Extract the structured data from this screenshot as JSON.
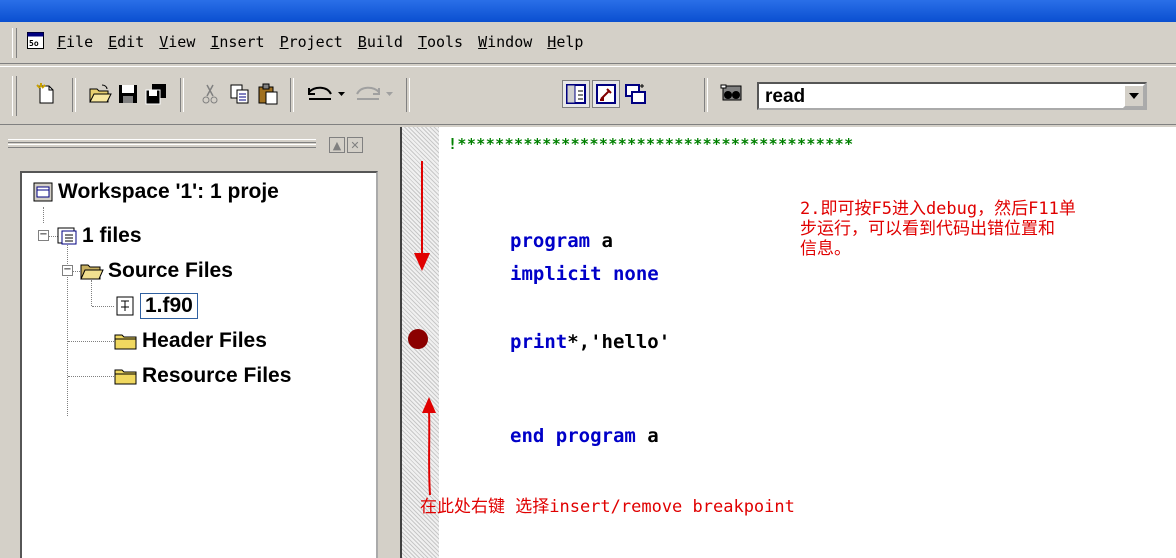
{
  "menu": {
    "items": [
      {
        "key": "F",
        "rest": "ile"
      },
      {
        "key": "E",
        "rest": "dit"
      },
      {
        "key": "V",
        "rest": "iew"
      },
      {
        "key": "I",
        "rest": "nsert"
      },
      {
        "key": "P",
        "rest": "roject"
      },
      {
        "key": "B",
        "rest": "uild"
      },
      {
        "key": "T",
        "rest": "ools"
      },
      {
        "key": "W",
        "rest": "indow"
      },
      {
        "key": "H",
        "rest": "elp"
      }
    ]
  },
  "toolbar": {
    "icons": [
      "new-file-icon",
      "open-folder-icon",
      "save-icon",
      "save-all-icon",
      "cut-icon",
      "copy-icon",
      "paste-icon",
      "undo-icon",
      "redo-icon",
      "workspace-icon",
      "output-icon",
      "window-list-icon",
      "find-in-files-icon"
    ],
    "find_value": "read"
  },
  "workspace": {
    "root": "Workspace '1': 1 proje",
    "project": "1 files",
    "folders": [
      "Source Files",
      "Header Files",
      "Resource Files"
    ],
    "file": "1.f90"
  },
  "editor": {
    "comment_stars": "!******************************************",
    "lines": [
      {
        "kw": "program",
        "rest": " a"
      },
      {
        "kw": "implicit none",
        "rest": ""
      },
      {
        "kw": "print",
        "rest": "*,'hello'"
      },
      {
        "kw": "end program",
        "rest": " a"
      }
    ]
  },
  "annotations": {
    "right_note": [
      "2.即可按F5进入debug，然后F11单",
      "步运行，可以看到代码出错位置和",
      "信息。"
    ],
    "bottom_note": "在此处右键 选择insert/remove breakpoint"
  },
  "colors": {
    "keyword": "#0000c8",
    "comment": "#008000",
    "annotation": "#e00000",
    "breakpoint": "#8b0000"
  }
}
